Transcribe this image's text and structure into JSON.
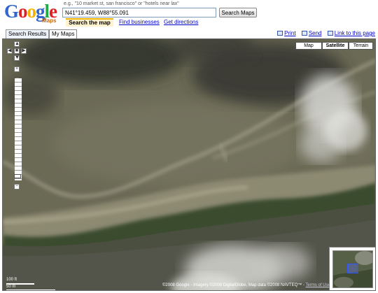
{
  "header": {
    "logo_text": "Google",
    "logo_sub": "Maps",
    "example_text": "e.g., \"10 market st, san francisco\" or \"hotels near lax\"",
    "search_value": "N41°19.459, W88°55.091",
    "search_button": "Search Maps",
    "tab_search_map": "Search the map",
    "link_find_businesses": "Find businesses",
    "link_get_directions": "Get directions"
  },
  "tabs": {
    "search_results": "Search Results",
    "my_maps": "My Maps"
  },
  "toplinks": {
    "print": "Print",
    "send": "Send",
    "link": "Link to this page"
  },
  "map": {
    "type_map": "Map",
    "type_satellite": "Satellite",
    "type_terrain": "Terrain",
    "selected_type": "Satellite",
    "scale_top": "100 ft",
    "scale_bottom": "50 m",
    "copyright": "©2008 Google - Imagery ©2008 DigitalGlobe, Map data ©2008 NAVTEQ™ -",
    "terms": "Terms of Use"
  },
  "colors": {
    "link": "#0000cc",
    "accent": "#f0b400"
  }
}
